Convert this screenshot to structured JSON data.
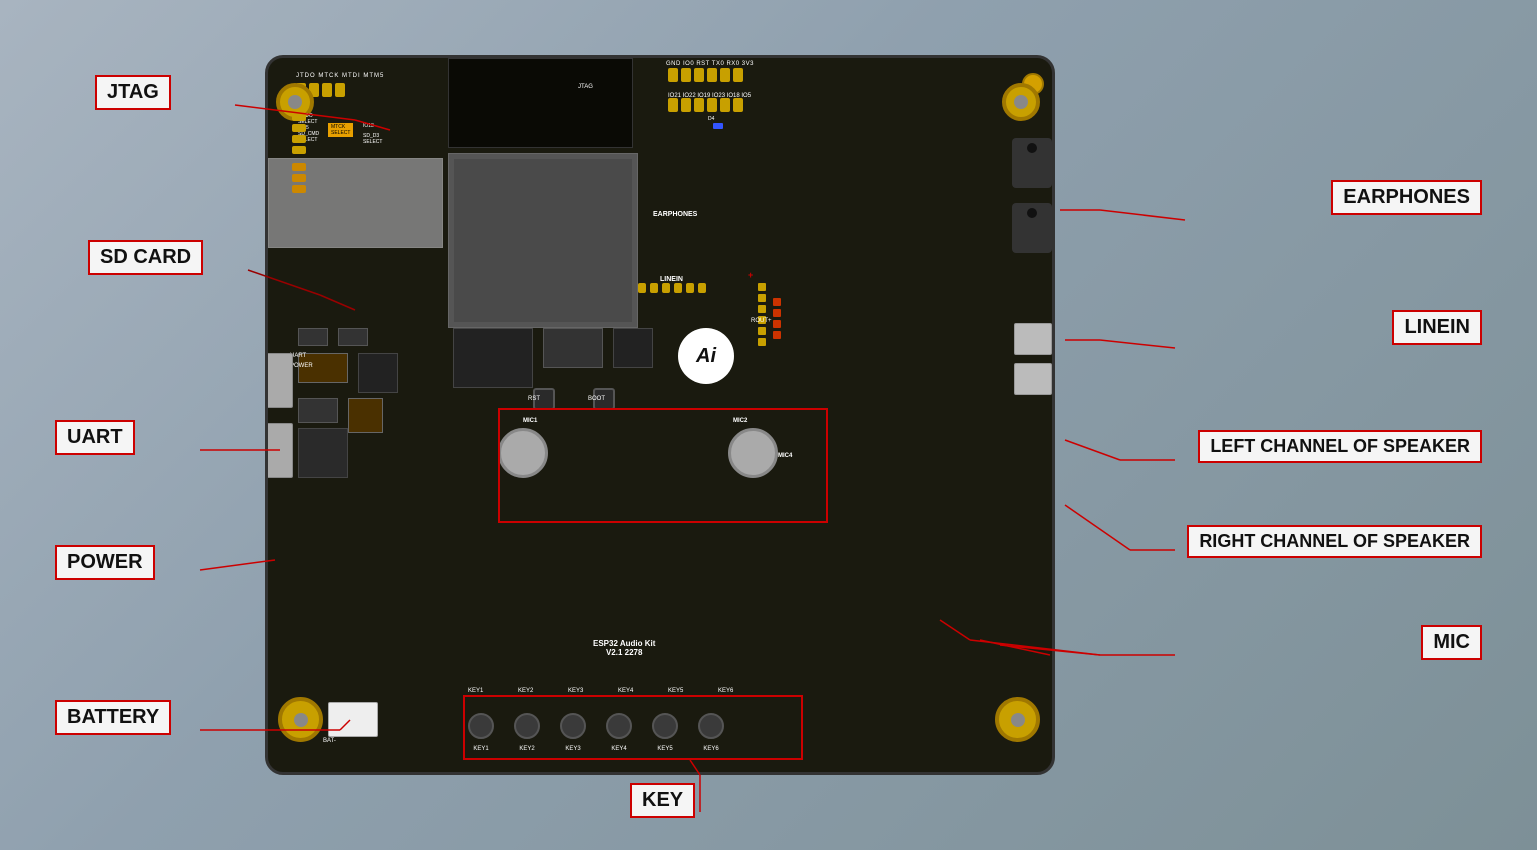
{
  "labels": {
    "jtag": "JTAG",
    "sd_card": "SD CARD",
    "uart": "UART",
    "power": "POWER",
    "battery": "BATTERY",
    "earphones": "EARPHONES",
    "linein": "LINEIN",
    "left_channel": "LEFT CHANNEL OF SPEAKER",
    "right_channel": "RIGHT CHANNEL OF SPEAKER",
    "mic": "MIC",
    "key": "KEY"
  },
  "board": {
    "title": "ESP32 Audio Kit V2.1",
    "subtitle": "2278"
  },
  "colors": {
    "label_border": "#cc0000",
    "label_bg": "#f0f0f0",
    "pcb": "#1a1a0f",
    "line": "#cc0000"
  }
}
